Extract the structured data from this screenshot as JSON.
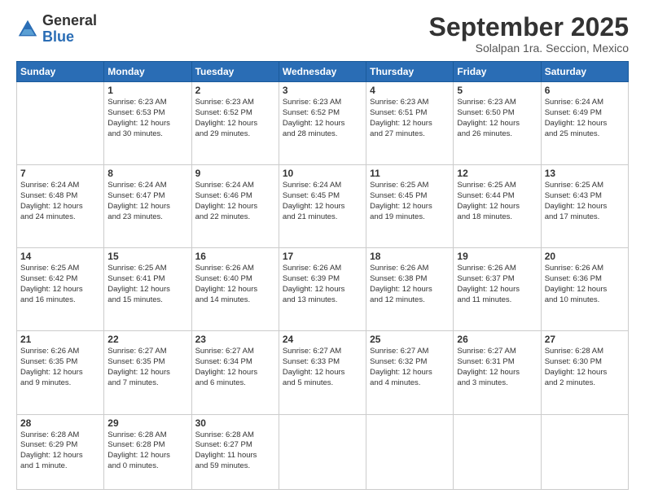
{
  "logo": {
    "general": "General",
    "blue": "Blue"
  },
  "header": {
    "title": "September 2025",
    "subtitle": "Solalpan 1ra. Seccion, Mexico"
  },
  "days_of_week": [
    "Sunday",
    "Monday",
    "Tuesday",
    "Wednesday",
    "Thursday",
    "Friday",
    "Saturday"
  ],
  "weeks": [
    [
      {
        "day": "",
        "info": ""
      },
      {
        "day": "1",
        "info": "Sunrise: 6:23 AM\nSunset: 6:53 PM\nDaylight: 12 hours\nand 30 minutes."
      },
      {
        "day": "2",
        "info": "Sunrise: 6:23 AM\nSunset: 6:52 PM\nDaylight: 12 hours\nand 29 minutes."
      },
      {
        "day": "3",
        "info": "Sunrise: 6:23 AM\nSunset: 6:52 PM\nDaylight: 12 hours\nand 28 minutes."
      },
      {
        "day": "4",
        "info": "Sunrise: 6:23 AM\nSunset: 6:51 PM\nDaylight: 12 hours\nand 27 minutes."
      },
      {
        "day": "5",
        "info": "Sunrise: 6:23 AM\nSunset: 6:50 PM\nDaylight: 12 hours\nand 26 minutes."
      },
      {
        "day": "6",
        "info": "Sunrise: 6:24 AM\nSunset: 6:49 PM\nDaylight: 12 hours\nand 25 minutes."
      }
    ],
    [
      {
        "day": "7",
        "info": "Sunrise: 6:24 AM\nSunset: 6:48 PM\nDaylight: 12 hours\nand 24 minutes."
      },
      {
        "day": "8",
        "info": "Sunrise: 6:24 AM\nSunset: 6:47 PM\nDaylight: 12 hours\nand 23 minutes."
      },
      {
        "day": "9",
        "info": "Sunrise: 6:24 AM\nSunset: 6:46 PM\nDaylight: 12 hours\nand 22 minutes."
      },
      {
        "day": "10",
        "info": "Sunrise: 6:24 AM\nSunset: 6:45 PM\nDaylight: 12 hours\nand 21 minutes."
      },
      {
        "day": "11",
        "info": "Sunrise: 6:25 AM\nSunset: 6:45 PM\nDaylight: 12 hours\nand 19 minutes."
      },
      {
        "day": "12",
        "info": "Sunrise: 6:25 AM\nSunset: 6:44 PM\nDaylight: 12 hours\nand 18 minutes."
      },
      {
        "day": "13",
        "info": "Sunrise: 6:25 AM\nSunset: 6:43 PM\nDaylight: 12 hours\nand 17 minutes."
      }
    ],
    [
      {
        "day": "14",
        "info": "Sunrise: 6:25 AM\nSunset: 6:42 PM\nDaylight: 12 hours\nand 16 minutes."
      },
      {
        "day": "15",
        "info": "Sunrise: 6:25 AM\nSunset: 6:41 PM\nDaylight: 12 hours\nand 15 minutes."
      },
      {
        "day": "16",
        "info": "Sunrise: 6:26 AM\nSunset: 6:40 PM\nDaylight: 12 hours\nand 14 minutes."
      },
      {
        "day": "17",
        "info": "Sunrise: 6:26 AM\nSunset: 6:39 PM\nDaylight: 12 hours\nand 13 minutes."
      },
      {
        "day": "18",
        "info": "Sunrise: 6:26 AM\nSunset: 6:38 PM\nDaylight: 12 hours\nand 12 minutes."
      },
      {
        "day": "19",
        "info": "Sunrise: 6:26 AM\nSunset: 6:37 PM\nDaylight: 12 hours\nand 11 minutes."
      },
      {
        "day": "20",
        "info": "Sunrise: 6:26 AM\nSunset: 6:36 PM\nDaylight: 12 hours\nand 10 minutes."
      }
    ],
    [
      {
        "day": "21",
        "info": "Sunrise: 6:26 AM\nSunset: 6:35 PM\nDaylight: 12 hours\nand 9 minutes."
      },
      {
        "day": "22",
        "info": "Sunrise: 6:27 AM\nSunset: 6:35 PM\nDaylight: 12 hours\nand 7 minutes."
      },
      {
        "day": "23",
        "info": "Sunrise: 6:27 AM\nSunset: 6:34 PM\nDaylight: 12 hours\nand 6 minutes."
      },
      {
        "day": "24",
        "info": "Sunrise: 6:27 AM\nSunset: 6:33 PM\nDaylight: 12 hours\nand 5 minutes."
      },
      {
        "day": "25",
        "info": "Sunrise: 6:27 AM\nSunset: 6:32 PM\nDaylight: 12 hours\nand 4 minutes."
      },
      {
        "day": "26",
        "info": "Sunrise: 6:27 AM\nSunset: 6:31 PM\nDaylight: 12 hours\nand 3 minutes."
      },
      {
        "day": "27",
        "info": "Sunrise: 6:28 AM\nSunset: 6:30 PM\nDaylight: 12 hours\nand 2 minutes."
      }
    ],
    [
      {
        "day": "28",
        "info": "Sunrise: 6:28 AM\nSunset: 6:29 PM\nDaylight: 12 hours\nand 1 minute."
      },
      {
        "day": "29",
        "info": "Sunrise: 6:28 AM\nSunset: 6:28 PM\nDaylight: 12 hours\nand 0 minutes."
      },
      {
        "day": "30",
        "info": "Sunrise: 6:28 AM\nSunset: 6:27 PM\nDaylight: 11 hours\nand 59 minutes."
      },
      {
        "day": "",
        "info": ""
      },
      {
        "day": "",
        "info": ""
      },
      {
        "day": "",
        "info": ""
      },
      {
        "day": "",
        "info": ""
      }
    ]
  ]
}
